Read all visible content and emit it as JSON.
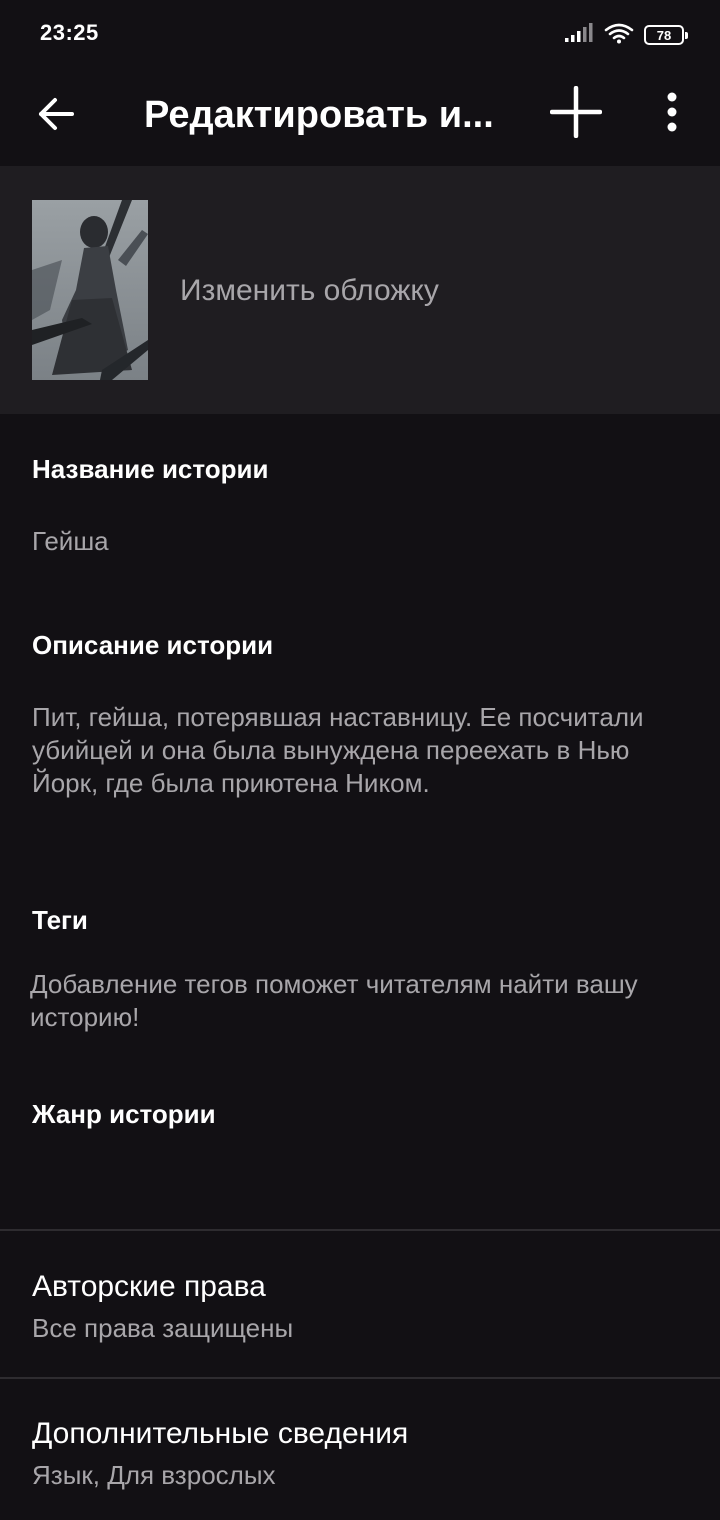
{
  "status_bar": {
    "time": "23:25",
    "battery_level": "78",
    "icons": [
      "signal-icon",
      "wifi-icon",
      "battery-icon"
    ]
  },
  "app_bar": {
    "title": "Редактировать и...",
    "icons": [
      "back-arrow-icon",
      "plus-icon",
      "more-vertical-icon"
    ]
  },
  "cover": {
    "change_label": "Изменить обложку"
  },
  "fields": {
    "title_label": "Название истории",
    "title_value": "Гейша",
    "description_label": "Описание истории",
    "description_value": "Пит, гейша, потерявшая наставницу. Ее посчитали убийцей и она была вынуждена переехать в Нью Йорк, где была приютена Ником.",
    "tags_label": "Теги",
    "tags_placeholder": "Добавление тегов поможет читателям найти вашу историю!",
    "genre_label": "Жанр истории"
  },
  "rows": {
    "copyright_title": "Авторские права",
    "copyright_value": "Все права защищены",
    "details_title": "Дополнительные сведения",
    "details_value": "Язык, Для взрослых"
  },
  "colors": {
    "background": "#121014",
    "cover_section": "#1f1d21",
    "primary_text": "#ffffff",
    "secondary_text": "#a8a6aa",
    "divider": "#2e2c30"
  }
}
